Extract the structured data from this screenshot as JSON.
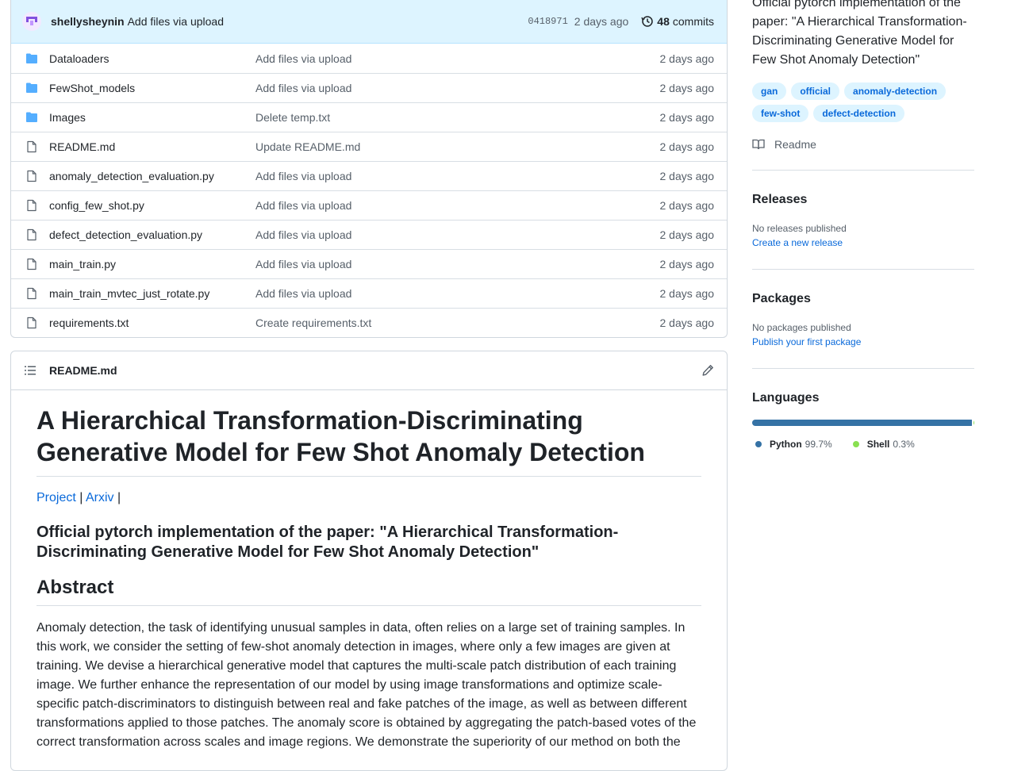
{
  "commit": {
    "author": "shellysheynin",
    "message": "Add files via upload",
    "sha": "0418971",
    "time": "2 days ago",
    "count": "48",
    "count_label": "commits"
  },
  "files": [
    {
      "type": "folder",
      "name": "Dataloaders",
      "message": "Add files via upload",
      "time": "2 days ago"
    },
    {
      "type": "folder",
      "name": "FewShot_models",
      "message": "Add files via upload",
      "time": "2 days ago"
    },
    {
      "type": "folder",
      "name": "Images",
      "message": "Delete temp.txt",
      "time": "2 days ago"
    },
    {
      "type": "file",
      "name": "README.md",
      "message": "Update README.md",
      "time": "2 days ago"
    },
    {
      "type": "file",
      "name": "anomaly_detection_evaluation.py",
      "message": "Add files via upload",
      "time": "2 days ago"
    },
    {
      "type": "file",
      "name": "config_few_shot.py",
      "message": "Add files via upload",
      "time": "2 days ago"
    },
    {
      "type": "file",
      "name": "defect_detection_evaluation.py",
      "message": "Add files via upload",
      "time": "2 days ago"
    },
    {
      "type": "file",
      "name": "main_train.py",
      "message": "Add files via upload",
      "time": "2 days ago"
    },
    {
      "type": "file",
      "name": "main_train_mvtec_just_rotate.py",
      "message": "Add files via upload",
      "time": "2 days ago"
    },
    {
      "type": "file",
      "name": "requirements.txt",
      "message": "Create requirements.txt",
      "time": "2 days ago"
    }
  ],
  "readme": {
    "filename": "README.md",
    "title": "A Hierarchical Transformation-Discriminating Generative Model for Few Shot Anomaly Detection",
    "link_project": "Project",
    "link_arxiv": "Arxiv",
    "sep": "|",
    "subtitle": "Official pytorch implementation of the paper: \"A Hierarchical Transformation-Discriminating Generative Model for Few Shot Anomaly Detection\"",
    "abstract_heading": "Abstract",
    "abstract": "Anomaly detection, the task of identifying unusual samples in data, often relies on a large set of training samples. In this work, we consider the setting of few-shot anomaly detection in images, where only a few images are given at training. We devise a hierarchical generative model that captures the multi-scale patch distribution of each training image. We further enhance the representation of our model by using image transformations and optimize scale-specific patch-discriminators to distinguish between real and fake patches of the image, as well as between different transformations applied to those patches. The anomaly score is obtained by aggregating the patch-based votes of the correct transformation across scales and image regions. We demonstrate the superiority of our method on both the"
  },
  "sidebar": {
    "about": "Official pytorch implementation of the paper: \"A Hierarchical Transformation-Discriminating Generative Model for Few Shot Anomaly Detection\"",
    "topics": [
      "gan",
      "official",
      "anomaly-detection",
      "few-shot",
      "defect-detection"
    ],
    "readme_label": "Readme",
    "releases": {
      "heading": "Releases",
      "none": "No releases published",
      "link": "Create a new release"
    },
    "packages": {
      "heading": "Packages",
      "none": "No packages published",
      "link": "Publish your first package"
    },
    "languages": {
      "heading": "Languages",
      "items": [
        {
          "name": "Python",
          "pct": "99.7%",
          "value": 99.7,
          "color": "#3572A5"
        },
        {
          "name": "Shell",
          "pct": "0.3%",
          "value": 0.3,
          "color": "#89e051"
        }
      ]
    }
  },
  "colors": {
    "accent": "#0969da",
    "folder": "#54aeff",
    "commit_bg": "#ddf4ff"
  }
}
